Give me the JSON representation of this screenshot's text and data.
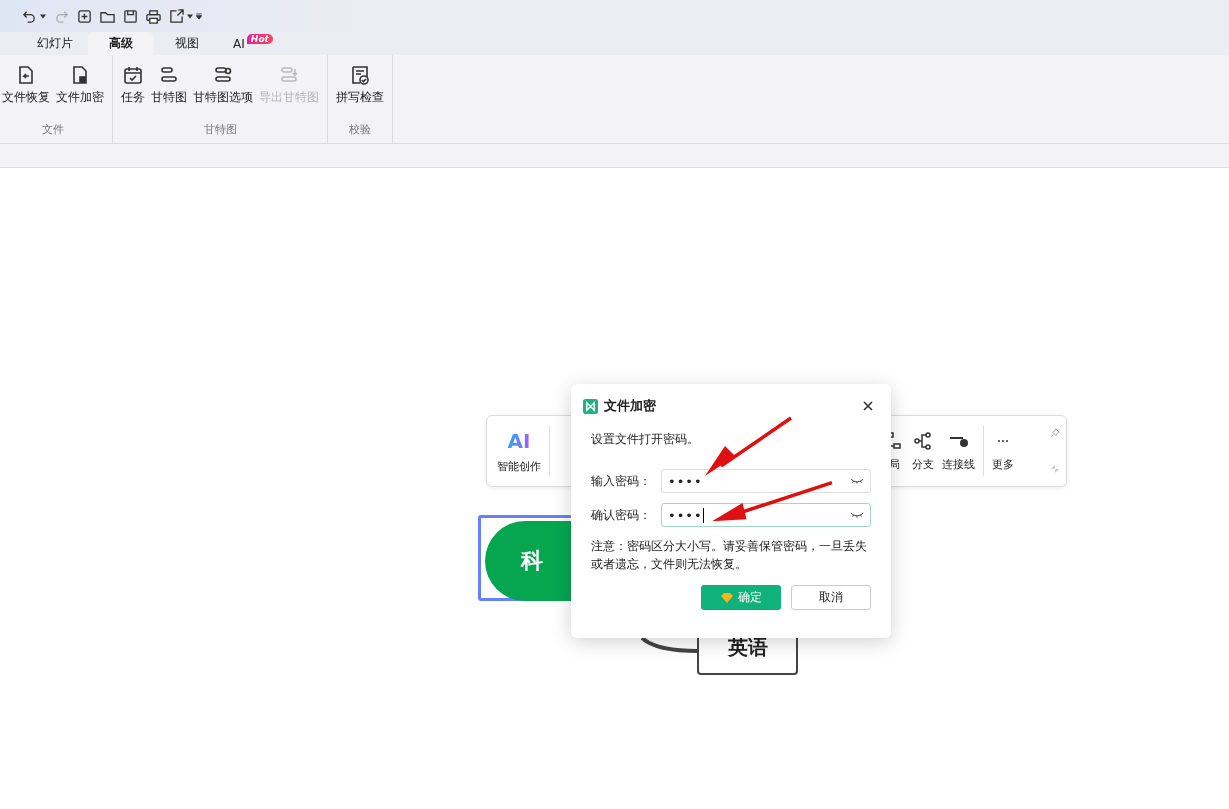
{
  "tabs": [
    {
      "label": "幻灯片",
      "selected": false
    },
    {
      "label": "高级",
      "selected": true
    },
    {
      "label": "视图",
      "selected": false
    },
    {
      "label": "AI",
      "selected": false,
      "badge": "Hot"
    }
  ],
  "ribbon": [
    {
      "group": "文件",
      "items": [
        {
          "label": "文件恢复",
          "disabled": false
        },
        {
          "label": "文件加密",
          "disabled": false
        }
      ]
    },
    {
      "group": "甘特图",
      "items": [
        {
          "label": "任务",
          "disabled": false
        },
        {
          "label": "甘特图",
          "disabled": false
        },
        {
          "label": "甘特图选项",
          "disabled": false
        },
        {
          "label": "导出甘特图",
          "disabled": true
        }
      ]
    },
    {
      "group": "校验",
      "items": [
        {
          "label": "拼写检查",
          "disabled": false
        }
      ]
    }
  ],
  "floating_toolbar": {
    "ai_logo": "AI",
    "ai_label": "智能创作",
    "items": [
      "局",
      "分支",
      "连接线",
      "更多"
    ]
  },
  "mind_map": {
    "root": "科",
    "child": "英语"
  },
  "dialog": {
    "title": "文件加密",
    "prompt": "设置文件打开密码。",
    "fields": [
      {
        "label": "输入密码：",
        "value": "••••",
        "focused": false
      },
      {
        "label": "确认密码：",
        "value": "••••",
        "focused": true
      }
    ],
    "note": "注意：密码区分大小写。请妥善保管密码，一旦丢失或者遗忘，文件则无法恢复。",
    "buttons": [
      {
        "label": "确定",
        "kind": "primary"
      },
      {
        "label": "取消",
        "kind": "secondary"
      }
    ]
  }
}
